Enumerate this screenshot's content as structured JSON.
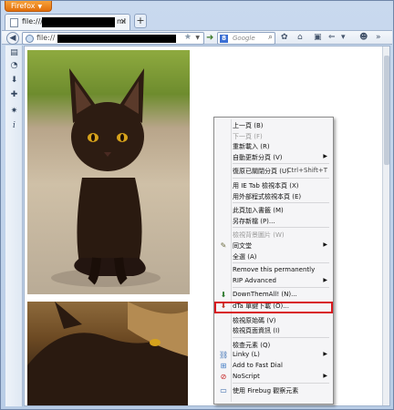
{
  "browser": {
    "app_button": "Firefox",
    "tab": {
      "title_prefix": "file:///F",
      "title_suffix": "ml"
    },
    "new_tab": "+",
    "url_prefix": "file://",
    "search_placeholder": "Google"
  },
  "context_menu": {
    "items": [
      {
        "label": "上一頁 (B)",
        "disabled": false
      },
      {
        "label": "下一頁 (F)",
        "disabled": true
      },
      {
        "label": "重新載入 (R)",
        "disabled": false
      },
      {
        "label": "自動更新分頁 (V)",
        "disabled": false,
        "submenu": true
      },
      {
        "sep": true
      },
      {
        "label": "復原已關閉分頁 (U)",
        "shortcut": "Ctrl+Shift+T",
        "disabled": false
      },
      {
        "sep": true
      },
      {
        "label": "用 IE Tab 檢視本頁 (X)",
        "disabled": false
      },
      {
        "label": "用外部程式檢視本頁 (E)",
        "disabled": false
      },
      {
        "sep": true
      },
      {
        "label": "此頁加入書籤 (M)",
        "disabled": false
      },
      {
        "label": "另存新檔 (P)...",
        "disabled": false
      },
      {
        "sep": true
      },
      {
        "label": "檢視背景圖片 (W)",
        "disabled": true
      },
      {
        "label": "同文堂",
        "disabled": false,
        "submenu": true,
        "icon": "tongwentang-icon"
      },
      {
        "label": "全選 (A)",
        "disabled": false
      },
      {
        "sep": true
      },
      {
        "label": "Remove this permanently",
        "disabled": false
      },
      {
        "label": "RIP Advanced",
        "disabled": false,
        "submenu": true
      },
      {
        "sep": true
      },
      {
        "label": "DownThemAll! (N)...",
        "disabled": false,
        "icon": "downthemall-icon"
      },
      {
        "label": "dTa 單鍵下載 (O)...",
        "disabled": false,
        "icon": "dta-oneclick-icon",
        "highlighted": true
      },
      {
        "sep": true
      },
      {
        "label": "檢視原始碼 (V)",
        "disabled": false
      },
      {
        "label": "檢視頁面資訊 (I)",
        "disabled": false
      },
      {
        "sep": true
      },
      {
        "label": "檢查元素 (Q)",
        "disabled": false
      },
      {
        "label": "Linky (L)",
        "disabled": false,
        "submenu": true,
        "icon": "linky-icon"
      },
      {
        "label": "Add to Fast Dial",
        "disabled": false,
        "icon": "fast-dial-icon"
      },
      {
        "label": "NoScript",
        "disabled": false,
        "submenu": true,
        "icon": "noscript-icon"
      },
      {
        "sep": true
      },
      {
        "label": "使用 Firebug 觀察元素",
        "disabled": false,
        "icon": "firebug-icon"
      }
    ]
  },
  "colors": {
    "highlight_border": "#d8191f",
    "firefox_orange": "#e2700c"
  }
}
